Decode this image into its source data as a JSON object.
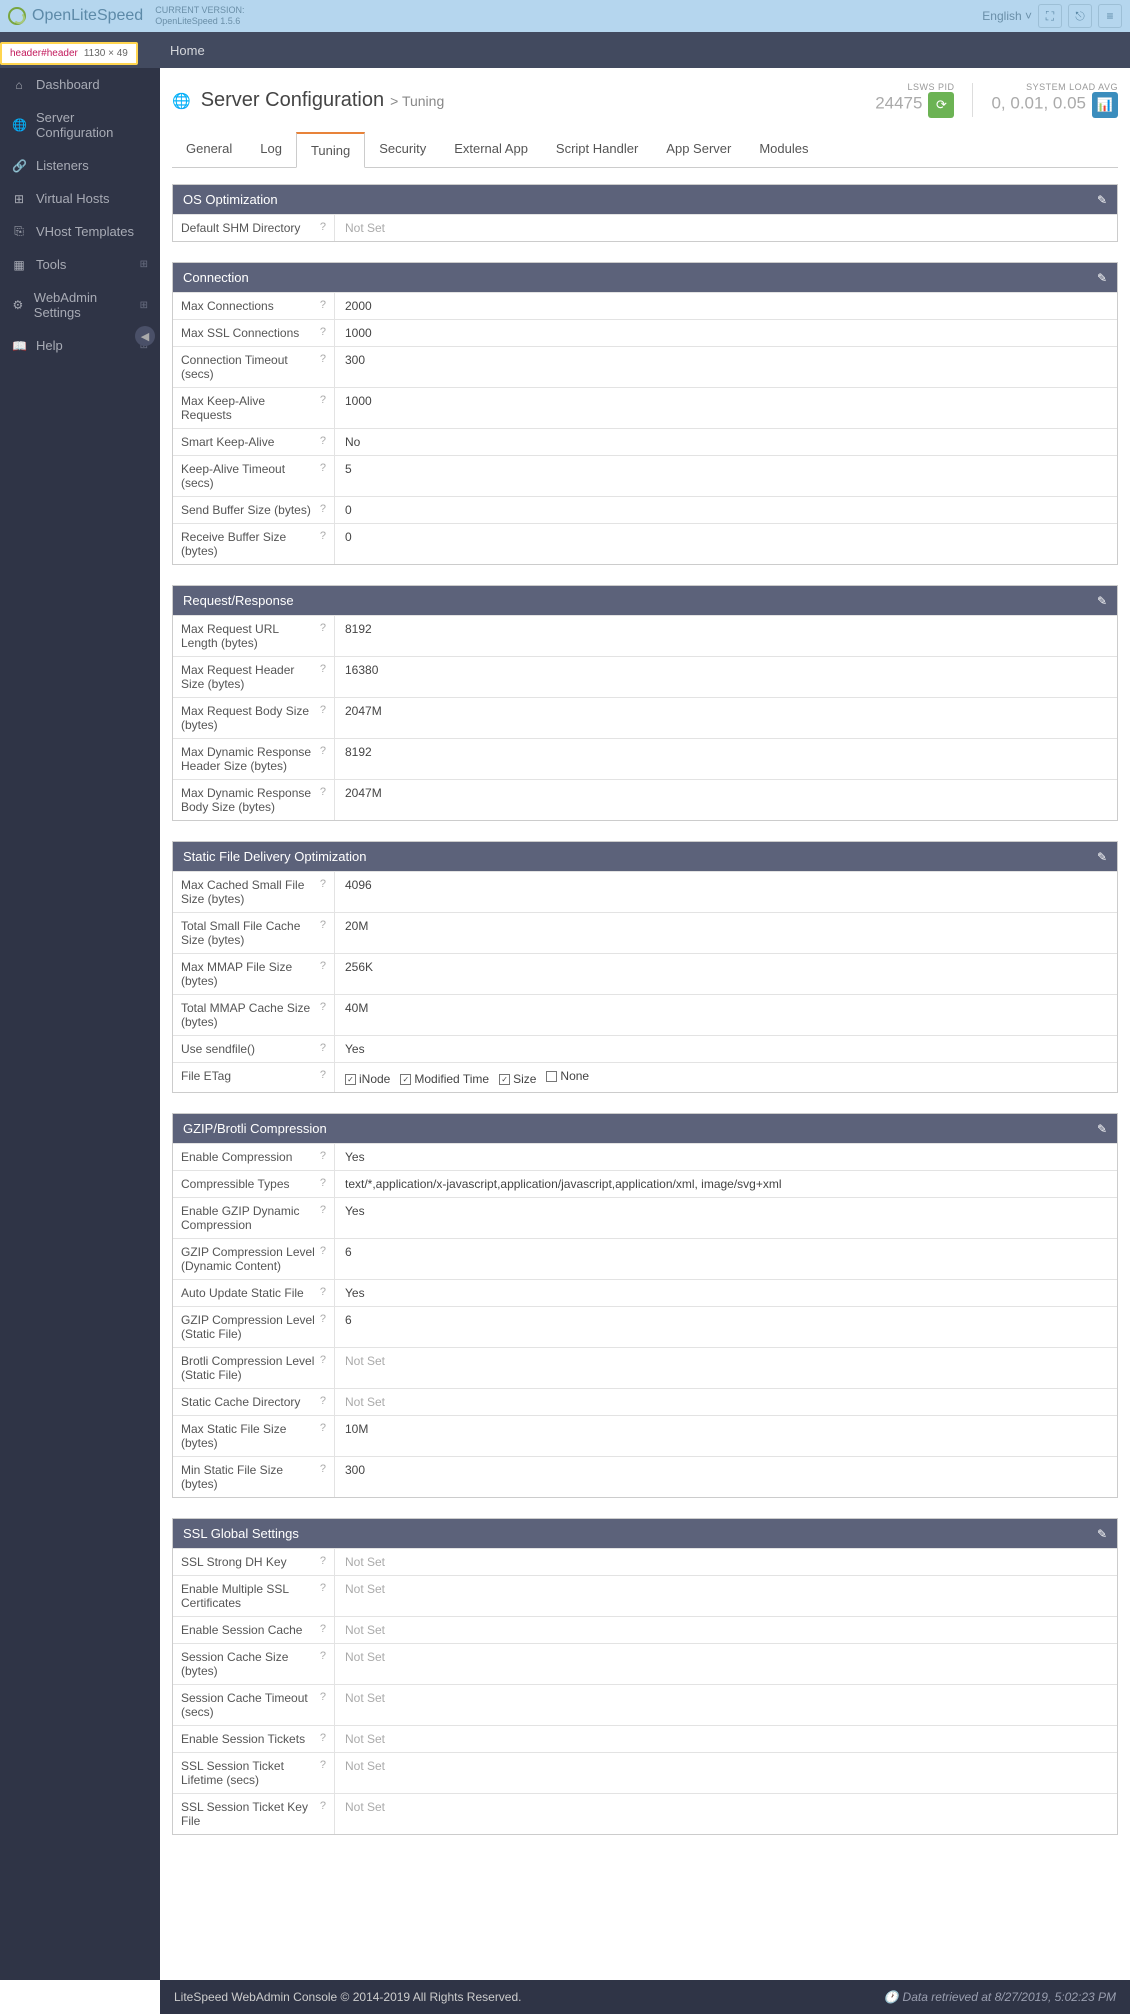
{
  "devBadge": {
    "selector": "header#header",
    "dim": "1130 × 49"
  },
  "brand": {
    "name": "OpenLiteSpeed",
    "versionLabel": "CURRENT VERSION:",
    "version": "OpenLiteSpeed 1.5.6"
  },
  "topbar": {
    "language": "English"
  },
  "breadcrumb": "Home",
  "sidebar": [
    {
      "icon": "⌂",
      "label": "Dashboard"
    },
    {
      "icon": "🌐",
      "label": "Server Configuration"
    },
    {
      "icon": "🔗",
      "label": "Listeners"
    },
    {
      "icon": "⊞",
      "label": "Virtual Hosts"
    },
    {
      "icon": "⎘",
      "label": "VHost Templates"
    },
    {
      "icon": "▦",
      "label": "Tools",
      "expand": true
    },
    {
      "icon": "⚙",
      "label": "WebAdmin Settings",
      "expand": true
    },
    {
      "icon": "📖",
      "label": "Help",
      "expand": true
    }
  ],
  "page": {
    "title": "Server Configuration",
    "sub": "> Tuning"
  },
  "stats": {
    "pidLabel": "LSWS PID",
    "pid": "24475",
    "loadLabel": "SYSTEM LOAD AVG",
    "load": "0, 0.01, 0.05"
  },
  "tabs": [
    "General",
    "Log",
    "Tuning",
    "Security",
    "External App",
    "Script Handler",
    "App Server",
    "Modules"
  ],
  "activeTab": 2,
  "panels": [
    {
      "title": "OS Optimization",
      "rows": [
        {
          "label": "Default SHM Directory",
          "value": "Not Set",
          "notset": true
        }
      ]
    },
    {
      "title": "Connection",
      "rows": [
        {
          "label": "Max Connections",
          "value": "2000"
        },
        {
          "label": "Max SSL Connections",
          "value": "1000"
        },
        {
          "label": "Connection Timeout (secs)",
          "value": "300"
        },
        {
          "label": "Max Keep-Alive Requests",
          "value": "1000"
        },
        {
          "label": "Smart Keep-Alive",
          "value": "No"
        },
        {
          "label": "Keep-Alive Timeout (secs)",
          "value": "5"
        },
        {
          "label": "Send Buffer Size (bytes)",
          "value": "0"
        },
        {
          "label": "Receive Buffer Size (bytes)",
          "value": "0"
        }
      ]
    },
    {
      "title": "Request/Response",
      "rows": [
        {
          "label": "Max Request URL Length (bytes)",
          "value": "8192"
        },
        {
          "label": "Max Request Header Size (bytes)",
          "value": "16380"
        },
        {
          "label": "Max Request Body Size (bytes)",
          "value": "2047M"
        },
        {
          "label": "Max Dynamic Response Header Size (bytes)",
          "value": "8192"
        },
        {
          "label": "Max Dynamic Response Body Size (bytes)",
          "value": "2047M"
        }
      ]
    },
    {
      "title": "Static File Delivery Optimization",
      "rows": [
        {
          "label": "Max Cached Small File Size (bytes)",
          "value": "4096"
        },
        {
          "label": "Total Small File Cache Size (bytes)",
          "value": "20M"
        },
        {
          "label": "Max MMAP File Size (bytes)",
          "value": "256K"
        },
        {
          "label": "Total MMAP Cache Size (bytes)",
          "value": "40M"
        },
        {
          "label": "Use sendfile()",
          "value": "Yes"
        },
        {
          "label": "File ETag",
          "etag": true
        }
      ]
    },
    {
      "title": "GZIP/Brotli Compression",
      "rows": [
        {
          "label": "Enable Compression",
          "value": "Yes"
        },
        {
          "label": "Compressible Types",
          "value": "text/*,application/x-javascript,application/javascript,application/xml, image/svg+xml"
        },
        {
          "label": "Enable GZIP Dynamic Compression",
          "value": "Yes"
        },
        {
          "label": "GZIP Compression Level (Dynamic Content)",
          "value": "6"
        },
        {
          "label": "Auto Update Static File",
          "value": "Yes"
        },
        {
          "label": "GZIP Compression Level (Static File)",
          "value": "6"
        },
        {
          "label": "Brotli Compression Level (Static File)",
          "value": "Not Set",
          "notset": true
        },
        {
          "label": "Static Cache Directory",
          "value": "Not Set",
          "notset": true
        },
        {
          "label": "Max Static File Size (bytes)",
          "value": "10M"
        },
        {
          "label": "Min Static File Size (bytes)",
          "value": "300"
        }
      ]
    },
    {
      "title": "SSL Global Settings",
      "rows": [
        {
          "label": "SSL Strong DH Key",
          "value": "Not Set",
          "notset": true
        },
        {
          "label": "Enable Multiple SSL Certificates",
          "value": "Not Set",
          "notset": true
        },
        {
          "label": "Enable Session Cache",
          "value": "Not Set",
          "notset": true
        },
        {
          "label": "Session Cache Size (bytes)",
          "value": "Not Set",
          "notset": true
        },
        {
          "label": "Session Cache Timeout (secs)",
          "value": "Not Set",
          "notset": true
        },
        {
          "label": "Enable Session Tickets",
          "value": "Not Set",
          "notset": true
        },
        {
          "label": "SSL Session Ticket Lifetime (secs)",
          "value": "Not Set",
          "notset": true
        },
        {
          "label": "SSL Session Ticket Key File",
          "value": "Not Set",
          "notset": true
        }
      ]
    }
  ],
  "etag": {
    "opts": [
      {
        "label": "iNode",
        "chk": true
      },
      {
        "label": "Modified Time",
        "chk": true
      },
      {
        "label": "Size",
        "chk": true
      },
      {
        "label": "None",
        "chk": false
      }
    ]
  },
  "footer": {
    "copy": "LiteSpeed WebAdmin Console © 2014-2019 All Rights Reserved.",
    "retrieved": "Data retrieved at 8/27/2019, 5:02:23 PM"
  }
}
